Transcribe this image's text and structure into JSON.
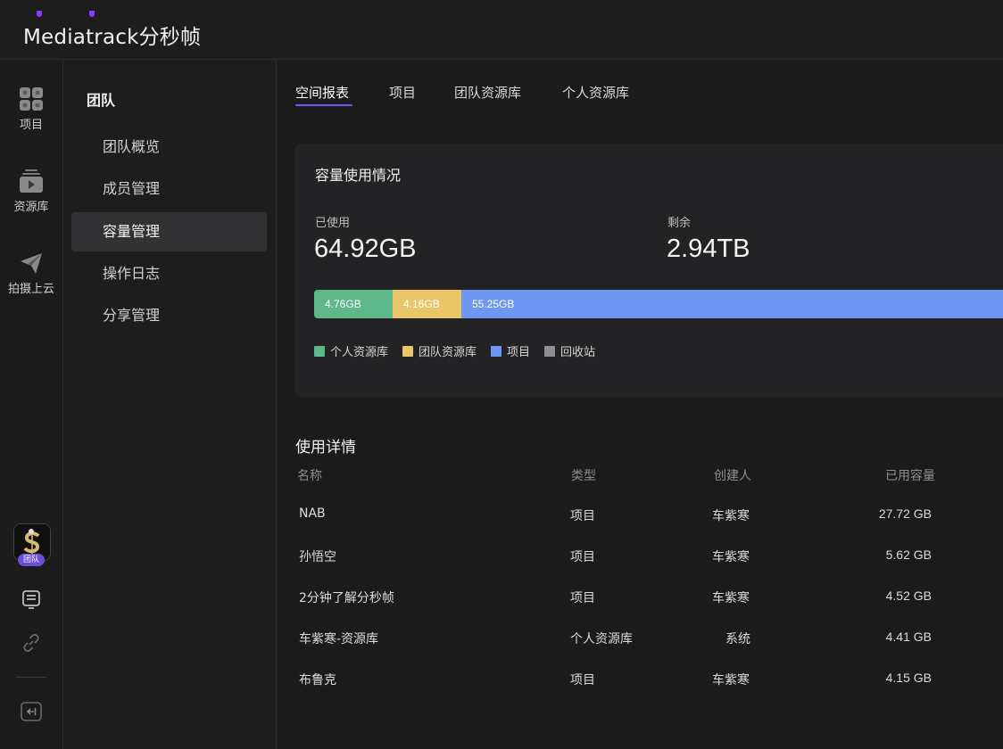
{
  "app": {
    "logo_text": "Mediatrack分秒帧"
  },
  "rail": {
    "items": [
      {
        "label": "项目",
        "icon": "grid-icon"
      },
      {
        "label": "资源库",
        "icon": "media-library-icon"
      },
      {
        "label": "拍摄上云",
        "icon": "paper-plane-icon"
      }
    ],
    "avatar_badge": "团队",
    "bottom_icons": [
      "queue-list-icon",
      "link-icon",
      "collapse-sidebar-icon"
    ]
  },
  "menu": {
    "title": "团队",
    "items": [
      {
        "label": "团队概览"
      },
      {
        "label": "成员管理"
      },
      {
        "label": "容量管理"
      },
      {
        "label": "操作日志"
      },
      {
        "label": "分享管理"
      }
    ],
    "active_index": 2
  },
  "tabs": [
    {
      "label": "空间报表"
    },
    {
      "label": "项目"
    },
    {
      "label": "团队资源库"
    },
    {
      "label": "个人资源库"
    }
  ],
  "capacity": {
    "title": "容量使用情况",
    "used_label": "已使用",
    "used_value": "64.92GB",
    "remaining_label": "剩余",
    "remaining_value": "2.94TB",
    "segments": [
      {
        "label": "4.76GB",
        "color": "#5fb88a",
        "value_gb": 4.76
      },
      {
        "label": "4.16GB",
        "color": "#e9c768",
        "value_gb": 4.16
      },
      {
        "label": "55.25GB",
        "color": "#6e96f3",
        "value_gb": 55.25
      }
    ],
    "legend": [
      {
        "label": "个人资源库",
        "color": "#5fb88a"
      },
      {
        "label": "团队资源库",
        "color": "#e9c768"
      },
      {
        "label": "项目",
        "color": "#6e96f3"
      },
      {
        "label": "回收站",
        "color": "#8e8e90"
      }
    ]
  },
  "details": {
    "title": "使用详情",
    "columns": {
      "name": "名称",
      "type": "类型",
      "creator": "创建人",
      "used": "已用容量"
    },
    "rows": [
      {
        "name": "NAB",
        "type": "项目",
        "creator": "车紫寒",
        "used": "27.72 GB"
      },
      {
        "name": "孙悟空",
        "type": "项目",
        "creator": "车紫寒",
        "used": "5.62 GB"
      },
      {
        "name": "2分钟了解分秒帧",
        "type": "项目",
        "creator": "车紫寒",
        "used": "4.52 GB"
      },
      {
        "name": "车紫寒-资源库",
        "type": "个人资源库",
        "creator": "系统",
        "used": "4.41 GB"
      },
      {
        "name": "布鲁克",
        "type": "项目",
        "creator": "车紫寒",
        "used": "4.15 GB"
      }
    ]
  }
}
